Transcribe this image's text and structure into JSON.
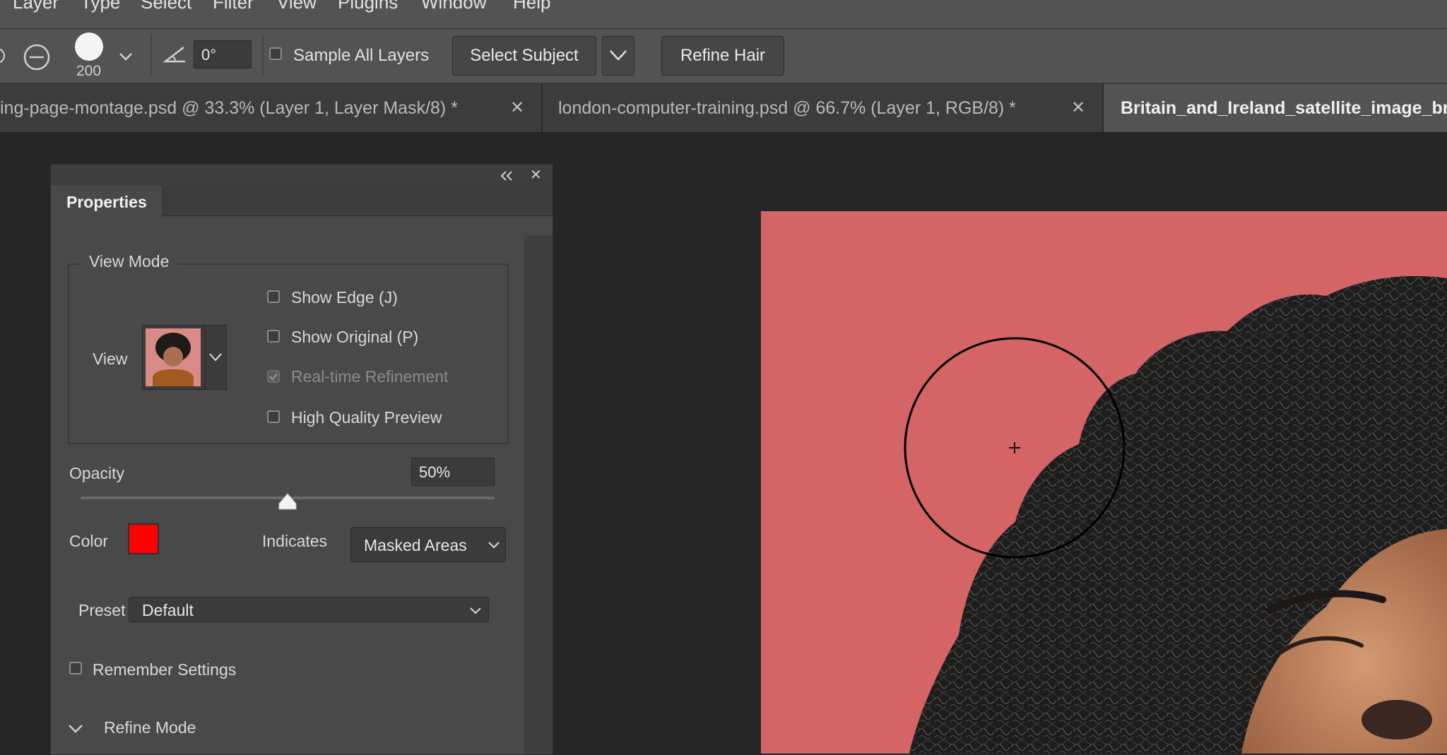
{
  "menu": {
    "items": [
      "Layer",
      "Type",
      "Select",
      "Filter",
      "View",
      "Plugins",
      "Window",
      "Help"
    ]
  },
  "options": {
    "brush_size": "200",
    "angle_value": "0°",
    "sample_all_layers": "Sample All Layers",
    "select_subject": "Select Subject",
    "refine_hair": "Refine Hair"
  },
  "tabs": [
    {
      "label": "ing-page-montage.psd @ 33.3% (Layer 1, Layer Mask/8) *",
      "active": false
    },
    {
      "label": "london-computer-training.psd @ 66.7% (Layer 1, RGB/8) *",
      "active": false
    },
    {
      "label": "Britain_and_Ireland_satellite_image_br",
      "active": true
    }
  ],
  "panel": {
    "title": "Properties",
    "view_mode": {
      "group_label": "View Mode",
      "view_label": "View",
      "show_edge": "Show Edge (J)",
      "show_original": "Show Original (P)",
      "realtime": "Real-time Refinement",
      "high_quality": "High Quality Preview"
    },
    "opacity_label": "Opacity",
    "opacity_value": "50%",
    "opacity_level": 0.5,
    "color_label": "Color",
    "overlay_color": "#ff0000",
    "indicates_label": "Indicates",
    "indicates_value": "Masked Areas",
    "preset_label": "Preset",
    "preset_value": "Default",
    "remember_settings": "Remember Settings",
    "refine_mode": "Refine Mode"
  },
  "colors": {
    "ui_bg": "#535353",
    "canvas_overlay": "#d46466"
  }
}
